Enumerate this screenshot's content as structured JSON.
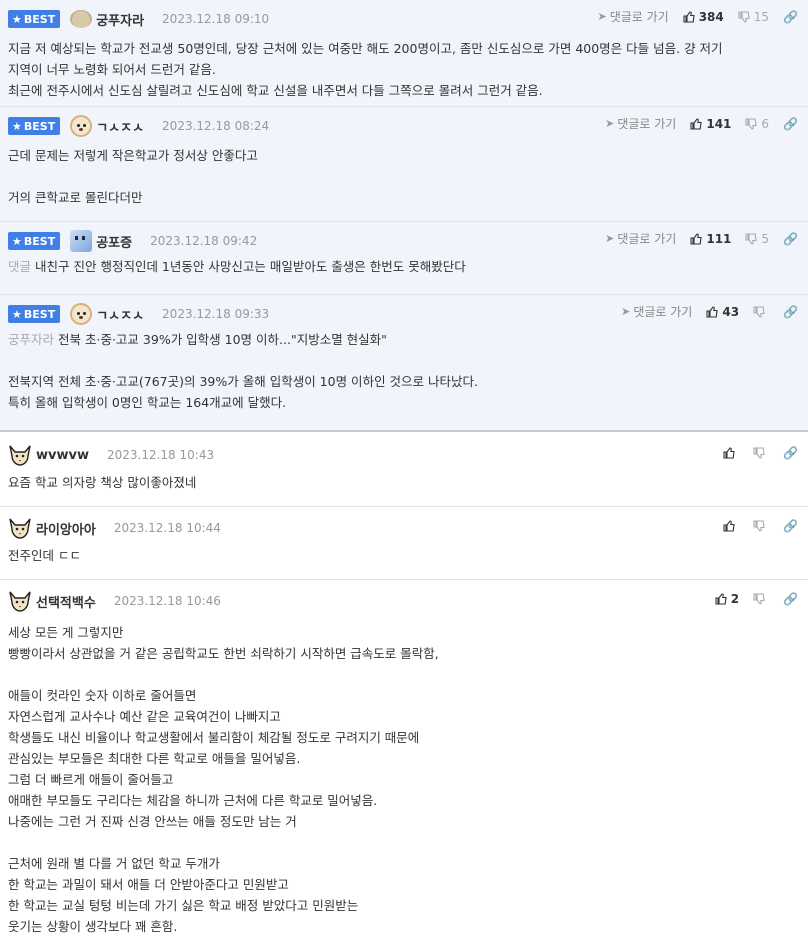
{
  "labels": {
    "best": "BEST",
    "reply": "댓글로 가기"
  },
  "colors": {
    "best_badge": "#3f7fe6",
    "best_bg": "#f1f4fa"
  },
  "comments": [
    {
      "nick": "궁푸자라",
      "date": "2023.12.18 09:10",
      "up": "384",
      "down": "15",
      "avatar": "beige-blob",
      "lines": [
        "지금 저 예상되는 학교가 전교생 50명인데, 당장 근처에 있는 여중만 해도 200명이고, 좀만 신도심으로 가면 400명은 다들 넘음. 걍 저기",
        "지역이 너무 노령화 되어서 드런거 같음.",
        "최근에 전주시에서 신도심 살릴려고 신도심에 학교 신설을 내주면서 다들 그쪽으로 몰려서 그런거 같음."
      ]
    },
    {
      "nick": "ㄱㅅㅈㅅ",
      "date": "2023.12.18 08:24",
      "up": "141",
      "down": "6",
      "avatar": "dog",
      "lines": [
        "근데 문제는 저렇게 작은학교가 정서상 안좋다고",
        "",
        "거의 큰학교로 몰린다더만"
      ]
    },
    {
      "nick": "공포증",
      "date": "2023.12.18 09:42",
      "up": "111",
      "down": "5",
      "avatar": "ghost",
      "tag": "댓글",
      "lines": [
        "내친구 진안 행정직인데 1년동안 사망신고는 매일받아도 출생은 한번도 못해봤단다"
      ]
    },
    {
      "nick": "ㄱㅅㅈㅅ",
      "date": "2023.12.18 09:33",
      "up": "43",
      "down": "",
      "avatar": "dog",
      "tag": "궁푸자라",
      "lines": [
        "전북 초·중·고교 39%가 입학생 10명 이하...\"지방소멸 현실화\"",
        "",
        "전북지역 전체 초·중·고교(767곳)의 39%가 올해 입학생이 10명 이하인 것으로 나타났다.",
        "특히 올해 입학생이 0명인 학교는 164개교에 달했다."
      ]
    },
    {
      "nick": "wvwvw",
      "date": "2023.12.18 10:43",
      "up": "",
      "down": "",
      "avatar": "fox",
      "lines": [
        "요즘 학교 의자랑 책상 많이좋아졌네"
      ]
    },
    {
      "nick": "라이앙아아",
      "date": "2023.12.18 10:44",
      "up": "",
      "down": "",
      "avatar": "fox",
      "lines": [
        "전주인데 ㄷㄷ"
      ]
    },
    {
      "nick": "선택적백수",
      "date": "2023.12.18 10:46",
      "up": "2",
      "down": "",
      "avatar": "fox",
      "lines": [
        "세상 모든 게 그렇지만",
        "빵빵이라서 상관없을 거 같은 공립학교도 한번 쇠락하기 시작하면 급속도로 몰락함,",
        "",
        "애들이 컷라인 숫자 이하로 줄어들면",
        "자연스럽게 교사수나 예산 같은 교육여건이 나빠지고",
        "학생들도 내신 비율이나 학교생활에서 불리함이 체감될 정도로 구려지기 때문에",
        "관심있는 부모들은 최대한 다른 학교로 애들을 밀어넣음.",
        "그럼 더 빠르게 애들이 줄어들고",
        "애매한 부모들도 구리다는 체감을 하니까 근처에 다른 학교로 밀어넣음.",
        "나중에는 그런 거 진짜 신경 안쓰는 애들 정도만 남는 거",
        "",
        "근처에 원래 별 다를 거 없던 학교 두개가",
        "한 학교는 과밀이 돼서 애들 더 안받아준다고 민원받고",
        "한 학교는 교실 텅텅 비는데 가기 싫은 학교 배정 받았다고 민원받는",
        "웃기는 상황이 생각보다 꽤 흔함."
      ]
    }
  ]
}
